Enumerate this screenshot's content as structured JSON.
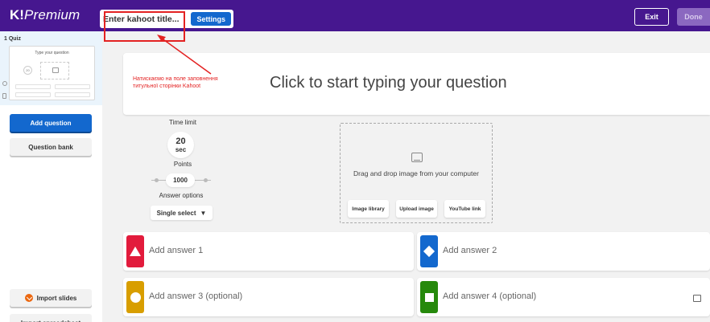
{
  "header": {
    "logo_mark": "K!",
    "logo_text": "Premium",
    "title_placeholder": "Enter kahoot title...",
    "settings_label": "Settings",
    "exit_label": "Exit",
    "done_label": "Done"
  },
  "sidebar": {
    "slide_label": "1 Quiz",
    "thumb_question": "Type your question",
    "thumb_timer": "20",
    "add_question_label": "Add question",
    "question_bank_label": "Question bank",
    "import_slides_label": "Import slides",
    "import_spreadsheet_label": "Import spreadsheet"
  },
  "annotation": {
    "line1": "Натискаємо на поле заповнення",
    "line2": "титульної сторінки Kahoot",
    "color": "#e32222"
  },
  "question": {
    "prompt": "Click to start typing your question"
  },
  "settings_panel": {
    "time_limit_label": "Time limit",
    "time_limit_value": "20",
    "time_limit_unit": "sec",
    "points_label": "Points",
    "points_value": "1000",
    "answer_options_label": "Answer options",
    "answer_options_value": "Single select",
    "answer_options_arrow": "▼"
  },
  "media": {
    "drag_text": "Drag and drop image from your computer",
    "image_library_label": "Image library",
    "upload_image_label": "Upload image",
    "youtube_label": "YouTube link"
  },
  "answers": [
    {
      "placeholder": "Add answer 1",
      "color": "#e21b3c",
      "icon": "triangle-icon"
    },
    {
      "placeholder": "Add answer 2",
      "color": "#1368ce",
      "icon": "diamond-icon"
    },
    {
      "placeholder": "Add answer 3 (optional)",
      "color": "#d89e00",
      "icon": "circle-icon"
    },
    {
      "placeholder": "Add answer 4 (optional)",
      "color": "#26890c",
      "icon": "square-icon"
    }
  ],
  "colors": {
    "topbar": "#46178f",
    "primary_button": "#1368ce"
  }
}
